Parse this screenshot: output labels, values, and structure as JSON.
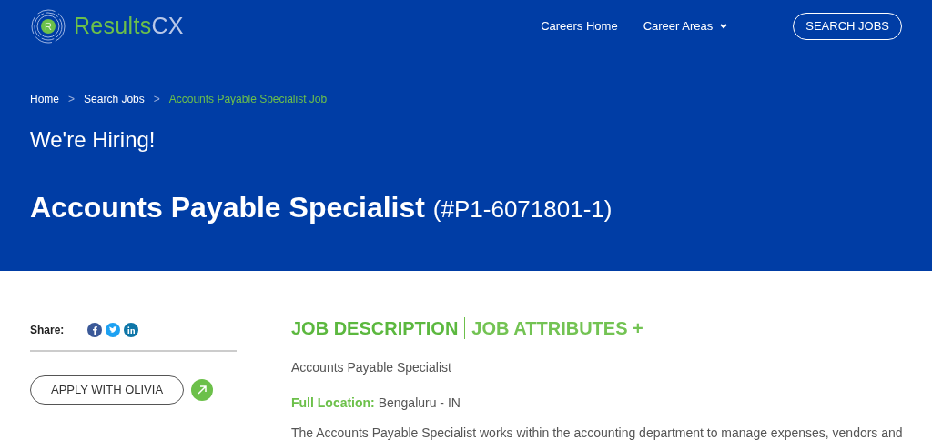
{
  "logo": {
    "text_main": "Results",
    "text_accent": "CX",
    "badge": "R"
  },
  "nav": {
    "links": [
      {
        "label": "Careers Home",
        "dropdown": false
      },
      {
        "label": "Career Areas",
        "dropdown": true
      }
    ],
    "search_button": "SEARCH JOBS"
  },
  "breadcrumb": [
    {
      "label": "Home",
      "current": false
    },
    {
      "label": "Search Jobs",
      "current": false
    },
    {
      "label": "Accounts Payable Specialist Job",
      "current": true
    }
  ],
  "breadcrumb_separator": ">",
  "hero": {
    "kicker": "We're Hiring!",
    "title": "Accounts Payable Specialist",
    "job_id": "(#P1-6071801-1)"
  },
  "share": {
    "label": "Share:",
    "networks": [
      {
        "kind": "facebook",
        "color": "#3b5998"
      },
      {
        "kind": "twitter",
        "color": "#1da1f2"
      },
      {
        "kind": "linkedin",
        "color": "#0e76a8"
      }
    ]
  },
  "apply_button": "APPLY WITH OLIVIA",
  "tabs": [
    {
      "label": "JOB DESCRIPTION",
      "selected": true
    },
    {
      "label": "JOB ATTRIBUTES +",
      "selected": false
    }
  ],
  "description": {
    "job_title": "Accounts Payable Specialist",
    "location_label": "Full Location:",
    "location_value": "Bengaluru - IN",
    "intro": "The Accounts Payable Specialist works within the accounting department to manage expenses, vendors and"
  }
}
